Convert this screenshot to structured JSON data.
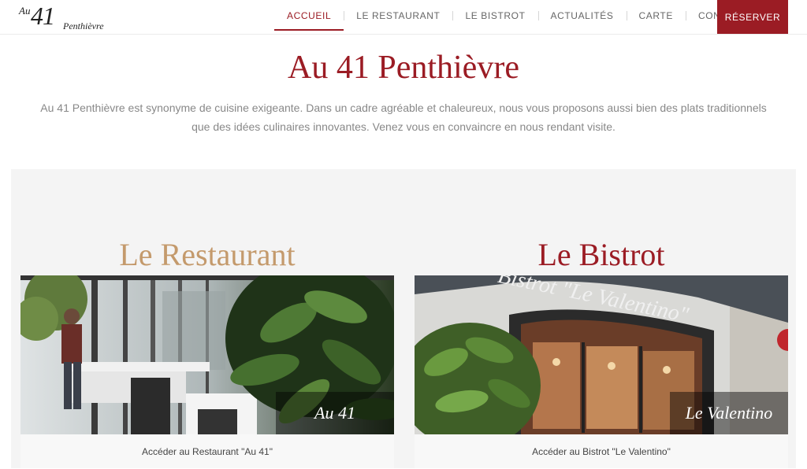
{
  "header": {
    "logo": {
      "au": "Au",
      "number": "41",
      "name": "Penthièvre"
    },
    "nav": [
      "ACCUEIL",
      "LE RESTAURANT",
      "LE BISTROT",
      "ACTUALITÉS",
      "CARTE",
      "CONTACT"
    ],
    "active_index": 0,
    "reserve_label": "RÉSERVER"
  },
  "hero": {
    "title": "Au 41 Penthièvre",
    "text": "Au 41 Penthièvre est synonyme de cuisine exigeante. Dans un cadre agréable et chaleureux, nous vous proposons aussi bien des plats traditionnels que des idées culinaires innovantes. Venez vous en convaincre en nous rendant visite."
  },
  "cards": [
    {
      "title": "Le Restaurant",
      "photo_label": "Au 41",
      "link": "Accéder au Restaurant \"Au 41\""
    },
    {
      "title": "Le Bistrot",
      "photo_label": "Le Valentino",
      "awning_text": "Bistrot \"Le Valentino\"",
      "link": "Accéder au Bistrot \"Le Valentino\""
    }
  ],
  "colors": {
    "brand": "#9b1c24",
    "gold": "#c49a6c",
    "section_bg": "#f4f4f4"
  }
}
